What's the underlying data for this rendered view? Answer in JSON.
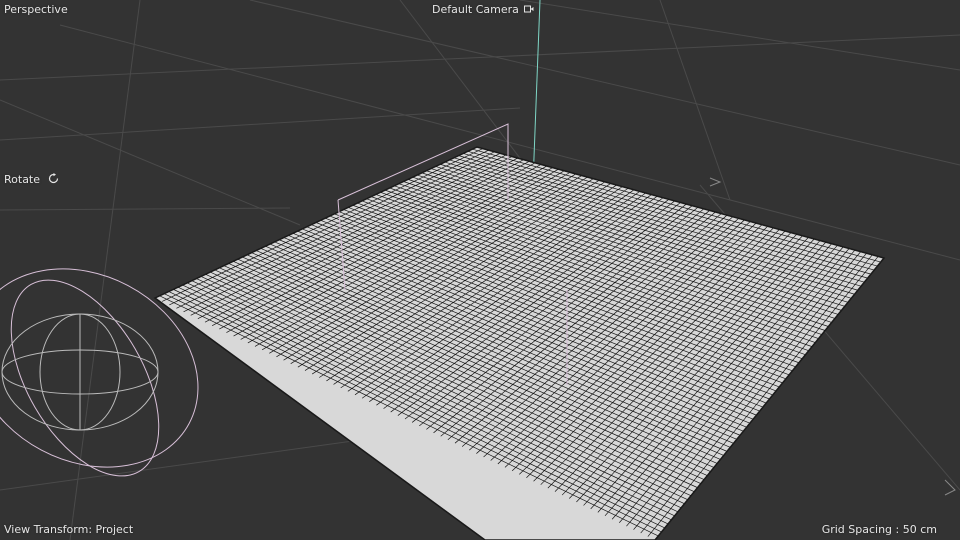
{
  "viewport": {
    "view_name": "Perspective",
    "camera_label": "Default Camera",
    "camera_icon": "camera-icon",
    "mode_label": "Rotate",
    "mode_icon": "rotate-icon",
    "view_transform": "View Transform: Project",
    "grid_spacing": "Grid Spacing : 50 cm"
  },
  "colors": {
    "background": "#333333",
    "floor_grid": "#4a4a4a",
    "mesh_line": "#141414",
    "mesh_fill": "#d8d8d8",
    "gizmo": "#d8c0d8",
    "y_axis": "#7fd6c6"
  }
}
